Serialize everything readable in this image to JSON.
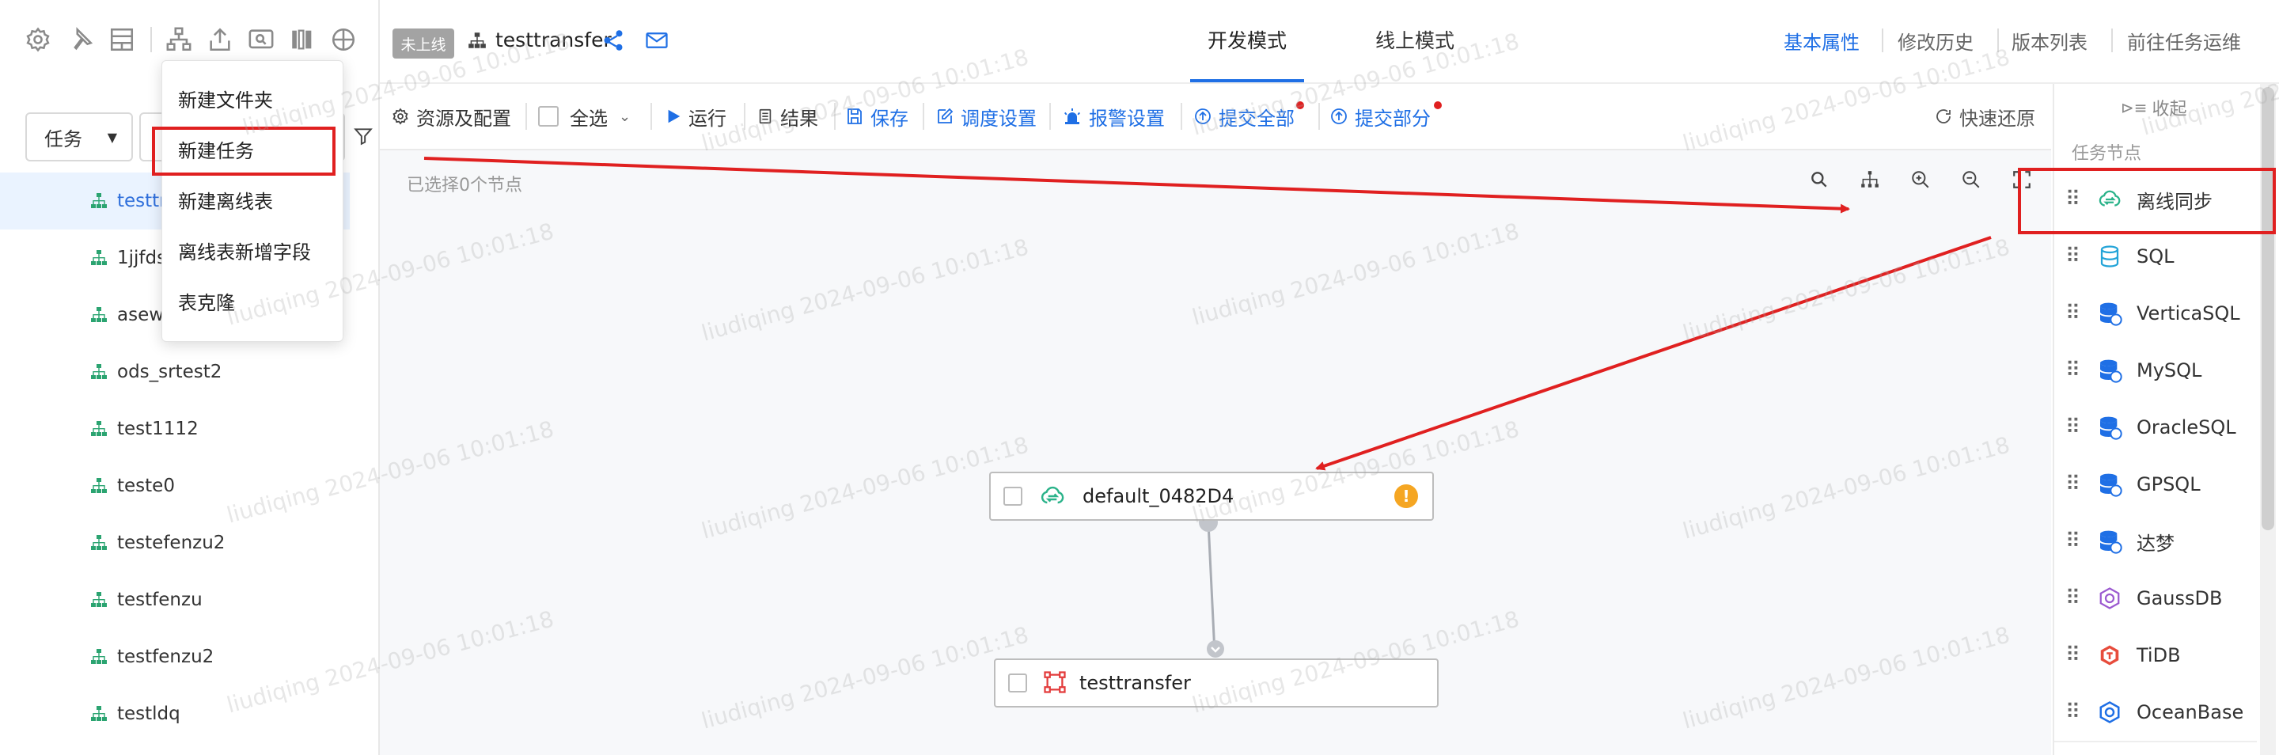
{
  "watermark": "liudiqing 2024-09-06 10:01:18",
  "sidebar": {
    "filter_type": "任务",
    "dropdown": {
      "items": [
        "新建文件夹",
        "新建任务",
        "新建离线表",
        "离线表新增字段",
        "表克隆"
      ],
      "highlighted": "新建任务"
    },
    "tree": [
      "testtr",
      "1jjfds",
      "asew",
      "ods_srtest2",
      "test1112",
      "teste0",
      "testefenzu2",
      "testfenzu",
      "testfenzu2",
      "testldq"
    ]
  },
  "header": {
    "status_tag": "未上线",
    "task_name": "testtransfer",
    "mode_tabs": [
      "开发模式",
      "线上模式"
    ],
    "active_mode": "开发模式",
    "links": [
      "基本属性",
      "修改历史",
      "版本列表",
      "前往任务运维"
    ],
    "active_link": "基本属性"
  },
  "toolbar": {
    "resource_config": "资源及配置",
    "select_all": "全选",
    "run": "运行",
    "result": "结果",
    "save": "保存",
    "schedule": "调度设置",
    "alarm": "报警设置",
    "submit_all": "提交全部",
    "submit_part": "提交部分",
    "quick_restore": "快速还原"
  },
  "canvas": {
    "selected_info": "已选择0个节点",
    "nodes": [
      {
        "label": "default_0482D4",
        "warning": "!"
      },
      {
        "label": "testtransfer"
      }
    ]
  },
  "right_panel": {
    "collapse": "收起",
    "section_title": "任务节点",
    "nodes": [
      "离线同步",
      "SQL",
      "VerticaSQL",
      "MySQL",
      "OracleSQL",
      "GPSQL",
      "达梦",
      "GaussDB",
      "TiDB",
      "OceanBase"
    ]
  },
  "colors": {
    "accent": "#1f6fe5",
    "annotation_red": "#e02020",
    "node_green": "#2bb38a"
  }
}
